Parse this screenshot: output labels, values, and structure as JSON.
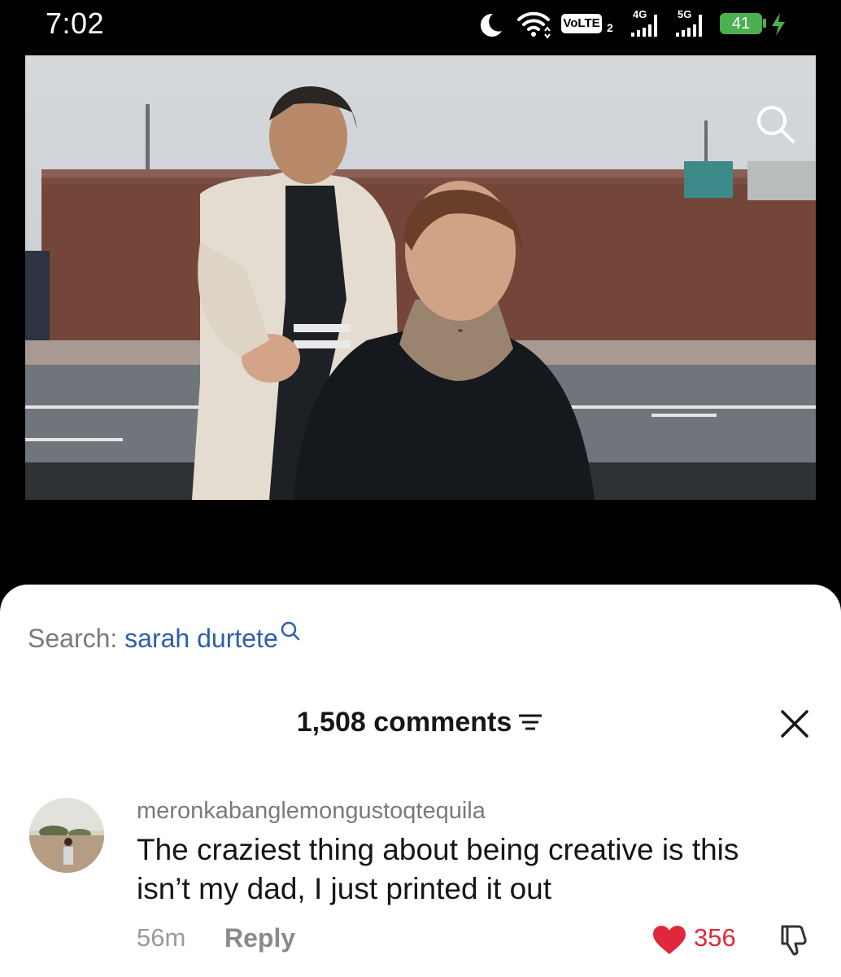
{
  "status_bar": {
    "time": "7:02",
    "volte": "VoLTE",
    "sim": "2",
    "network_1": "4G",
    "network_2": "5G",
    "battery": "41",
    "icons": [
      "moon-icon",
      "wifi-icon",
      "signal-icon",
      "battery-icon",
      "charging-icon"
    ]
  },
  "video": {
    "search_icon": "search-icon"
  },
  "search_suggestion": {
    "prefix": "Search:",
    "term": "sarah durtete"
  },
  "comments": {
    "count_label": "1,508 comments",
    "items": [
      {
        "username": "meronkabanglemongustoqtequila",
        "text": "The craziest thing about being creative is this isn’t my dad, I just printed it out",
        "time": "56m",
        "reply_label": "Reply",
        "likes": "356"
      }
    ]
  },
  "colors": {
    "link_blue": "#2e5fa8",
    "like_red": "#e0283a",
    "battery_green": "#4caf50"
  }
}
